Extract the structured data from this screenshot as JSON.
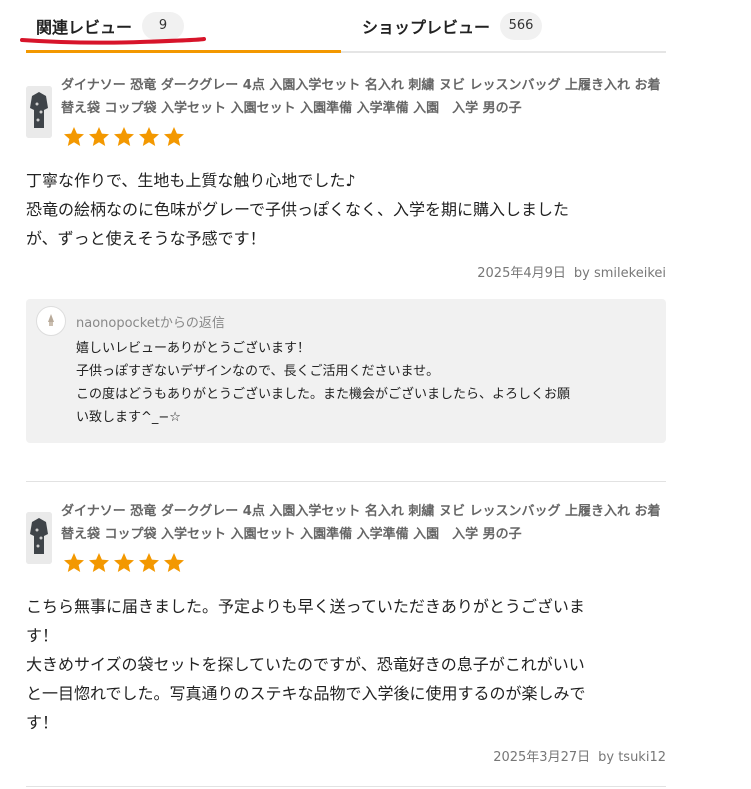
{
  "tabs": [
    {
      "label": "関連レビュー",
      "count": "9",
      "active": true
    },
    {
      "label": "ショップレビュー",
      "count": "566",
      "active": false
    }
  ],
  "colors": {
    "accent": "#f39800",
    "annotation": "#d7142a",
    "star": "#f39800"
  },
  "reviews": [
    {
      "product_name": "ダイナソー 恐竜 ダークグレー 4点 入園入学セット 名入れ 刺繍 ヌビ レッスンバッグ 上履き入れ お着替え袋 コップ袋 入学セット 入園セット 入園準備 入学準備 入園　入学 男の子",
      "rating": 5,
      "body": "丁寧な作りで、生地も上質な触り心地でした♪\n恐竜の絵柄なのに色味がグレーで子供っぽくなく、入学を期に購入しました\nが、ずっと使えそうな予感です！",
      "date": "2025年4月9日",
      "author": "by smilekeikei",
      "reply": {
        "from": "naonopocketからの返信",
        "text": "嬉しいレビューありがとうございます！\n子供っぽすぎないデザインなので、長くご活用くださいませ。\nこの度はどうもありがとうございました。また機会がございましたら、よろしくお願\nい致します^_−☆"
      }
    },
    {
      "product_name": "ダイナソー 恐竜 ダークグレー 4点 入園入学セット 名入れ 刺繍 ヌビ レッスンバッグ 上履き入れ お着替え袋 コップ袋 入学セット 入園セット 入園準備 入学準備 入園　入学 男の子",
      "rating": 5,
      "body": "こちら無事に届きました。予定よりも早く送っていただきありがとうございま\nす！\n大きめサイズの袋セットを探していたのですが、恐竜好きの息子がこれがいい\nと一目惚れでした。写真通りのステキな品物で入学後に使用するのが楽しみで\nす！",
      "date": "2025年3月27日",
      "author": "by tsuki12"
    }
  ]
}
